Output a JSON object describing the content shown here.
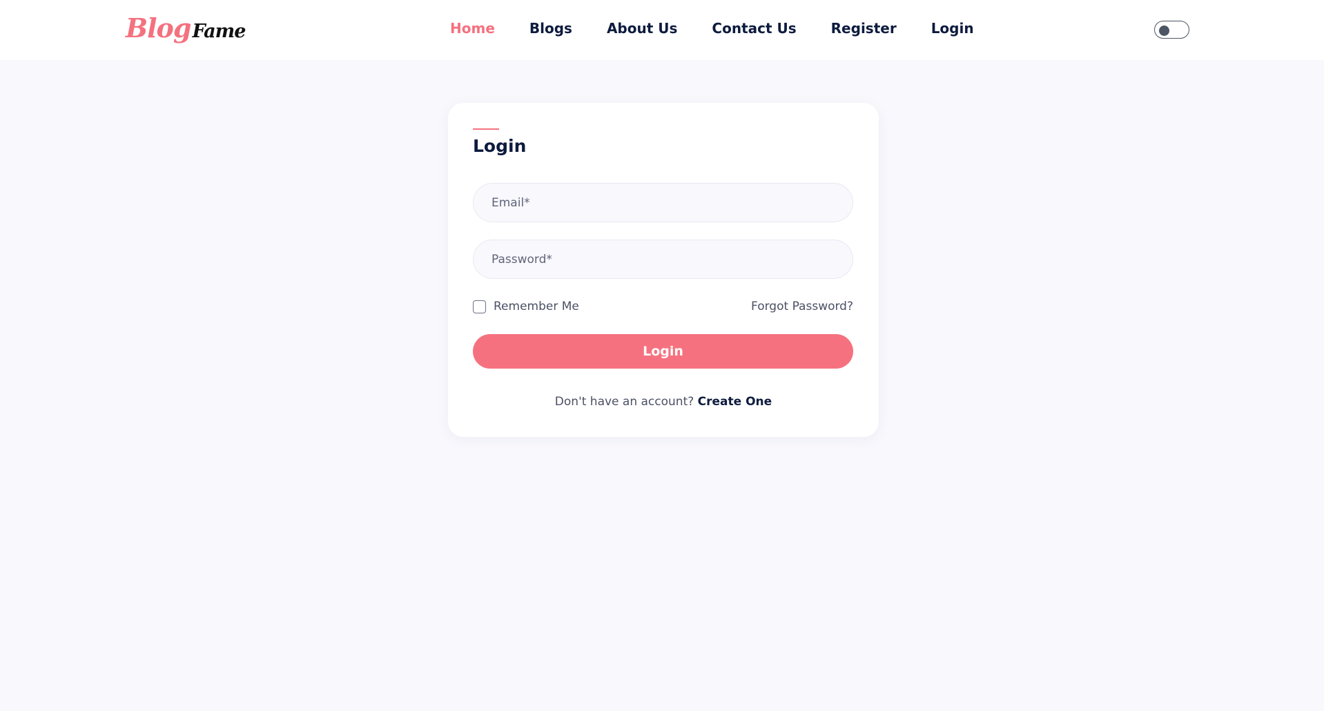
{
  "header": {
    "logo": {
      "part1": "Blog",
      "part2": "Fame"
    },
    "nav": [
      {
        "label": "Home",
        "active": true
      },
      {
        "label": "Blogs",
        "active": false
      },
      {
        "label": "About Us",
        "active": false
      },
      {
        "label": "Contact Us",
        "active": false
      },
      {
        "label": "Register",
        "active": false
      },
      {
        "label": "Login",
        "active": false
      }
    ],
    "theme_toggle": {
      "state": "off"
    }
  },
  "login_form": {
    "title": "Login",
    "email": {
      "placeholder": "Email*",
      "value": ""
    },
    "password": {
      "placeholder": "Password*",
      "value": ""
    },
    "remember_me": {
      "label": "Remember Me",
      "checked": false
    },
    "forgot_password": "Forgot Password?",
    "submit_label": "Login",
    "signup_prompt": "Don't have an account? ",
    "signup_link": "Create One"
  },
  "colors": {
    "accent": "#f4717f",
    "text_primary": "#0d1b3e",
    "text_secondary": "#4b5064",
    "page_background": "#f8f8fd",
    "card_background": "#ffffff"
  }
}
